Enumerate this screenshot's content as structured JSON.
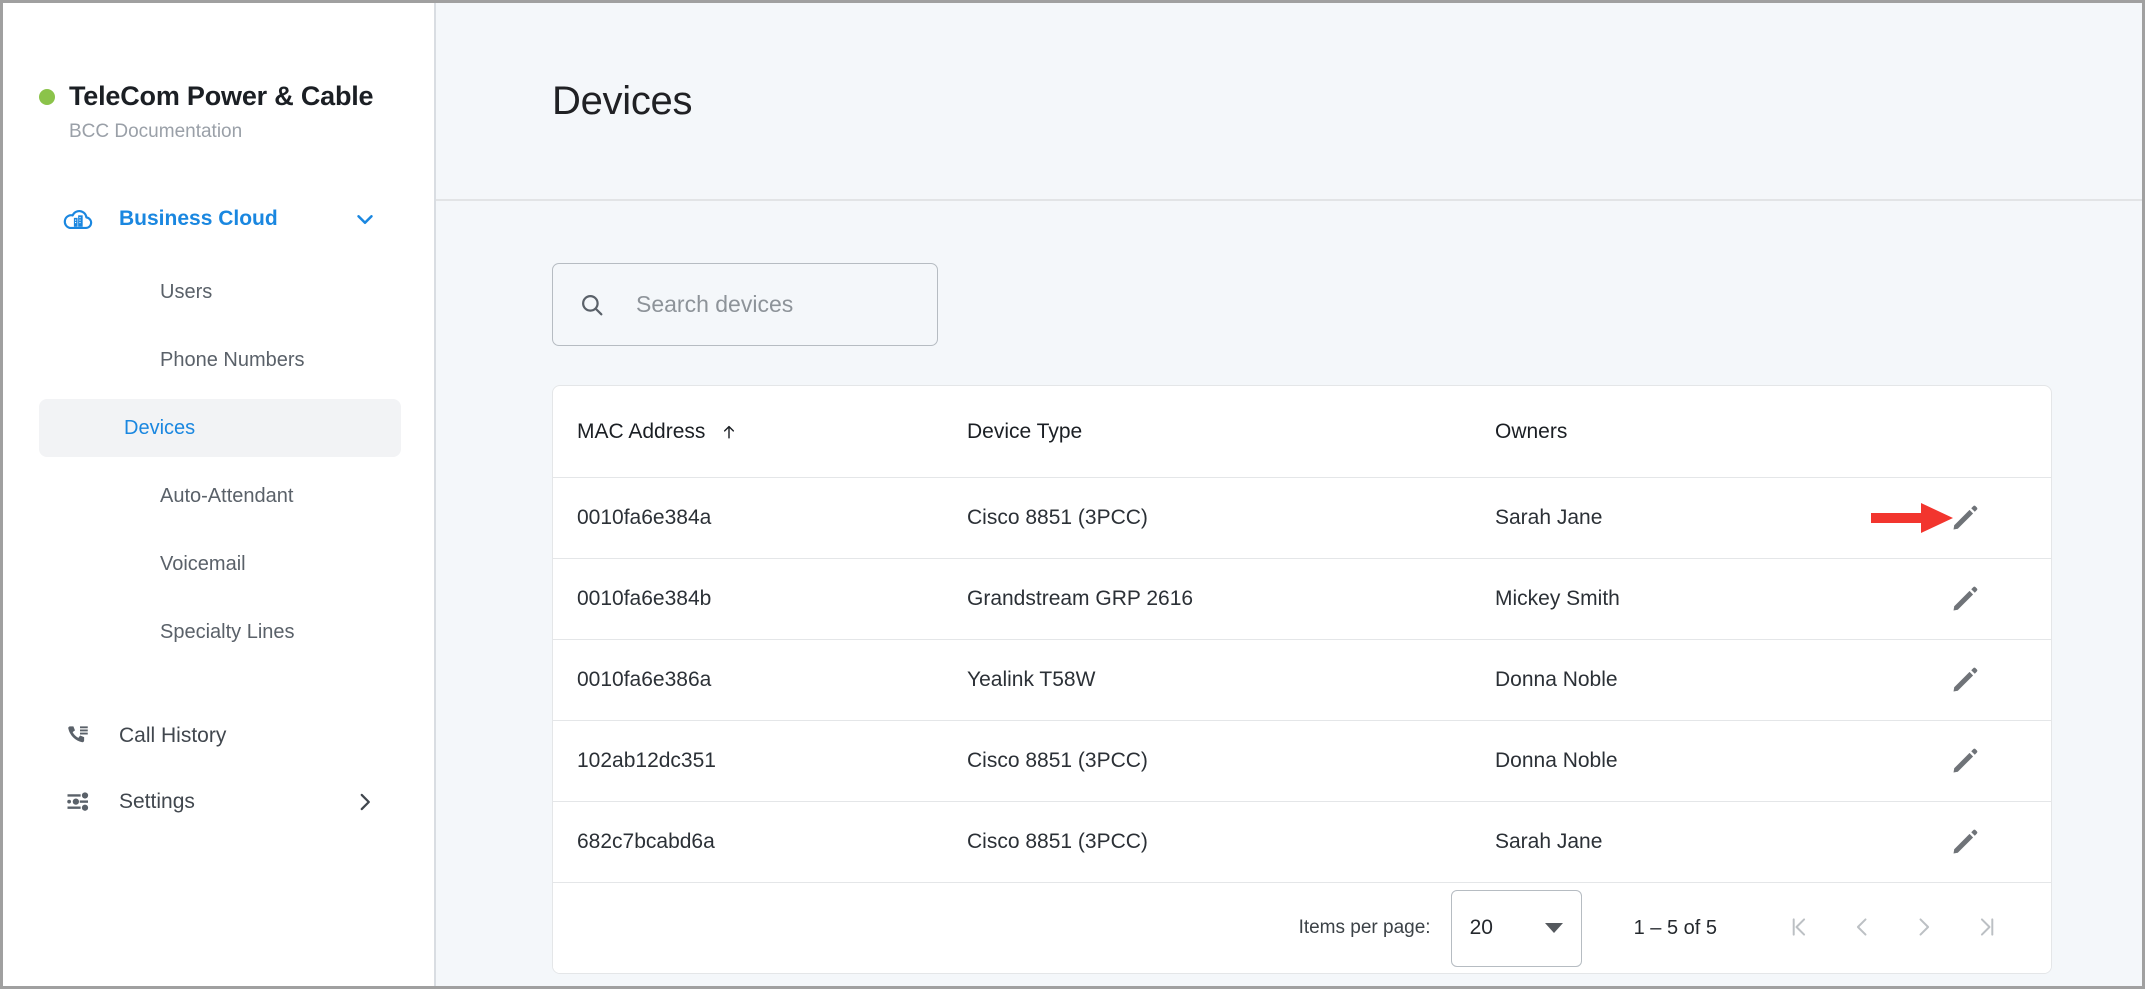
{
  "sidebar": {
    "brand": {
      "status_dot_color": "#8bc34a",
      "title": "TeleCom Power & Cable",
      "subtitle": "BCC Documentation"
    },
    "group": {
      "icon": "business-cloud-icon",
      "label": "Business Cloud",
      "expanded": true,
      "chevron": "chevron-down-icon",
      "accent_color": "#1a87e0",
      "items": [
        {
          "label": "Users",
          "active": false
        },
        {
          "label": "Phone Numbers",
          "active": false
        },
        {
          "label": "Devices",
          "active": true
        },
        {
          "label": "Auto-Attendant",
          "active": false
        },
        {
          "label": "Voicemail",
          "active": false
        },
        {
          "label": "Specialty Lines",
          "active": false
        }
      ]
    },
    "bottom_items": [
      {
        "label": "Call History",
        "icon": "phone-list-icon",
        "chevron": null
      },
      {
        "label": "Settings",
        "icon": "tune-sliders-icon",
        "chevron": "chevron-right-icon"
      }
    ]
  },
  "header": {
    "title": "Devices"
  },
  "search": {
    "icon": "search-icon",
    "placeholder": "Search devices",
    "value": ""
  },
  "table": {
    "columns": [
      {
        "key": "mac",
        "label": "MAC Address",
        "sort": "asc",
        "sort_icon": "arrow-up-icon"
      },
      {
        "key": "type",
        "label": "Device Type",
        "sort": null
      },
      {
        "key": "owners",
        "label": "Owners",
        "sort": null
      },
      {
        "key": "actions",
        "label": "",
        "sort": null
      }
    ],
    "rows": [
      {
        "mac": "0010fa6e384a",
        "type": "Cisco 8851 (3PCC)",
        "owners": "Sarah Jane",
        "action_icon": "edit-pencil-icon",
        "annotated": true
      },
      {
        "mac": "0010fa6e384b",
        "type": "Grandstream GRP 2616",
        "owners": "Mickey Smith",
        "action_icon": "edit-pencil-icon",
        "annotated": false
      },
      {
        "mac": "0010fa6e386a",
        "type": "Yealink T58W",
        "owners": "Donna Noble",
        "action_icon": "edit-pencil-icon",
        "annotated": false
      },
      {
        "mac": "102ab12dc351",
        "type": "Cisco 8851 (3PCC)",
        "owners": "Donna Noble",
        "action_icon": "edit-pencil-icon",
        "annotated": false
      },
      {
        "mac": "682c7bcabd6a",
        "type": "Cisco 8851 (3PCC)",
        "owners": "Sarah Jane",
        "action_icon": "edit-pencil-icon",
        "annotated": false
      }
    ]
  },
  "paginator": {
    "items_per_page_label": "Items per page:",
    "items_per_page_value": "20",
    "range_label": "1 – 5 of 5",
    "buttons": [
      {
        "name": "first-page-button",
        "icon": "first-page-icon",
        "disabled": true
      },
      {
        "name": "previous-page-button",
        "icon": "chevron-left-icon",
        "disabled": true
      },
      {
        "name": "next-page-button",
        "icon": "chevron-right-icon",
        "disabled": true
      },
      {
        "name": "last-page-button",
        "icon": "last-page-icon",
        "disabled": true
      }
    ]
  },
  "annotation": {
    "arrow_color": "#f2352e",
    "points_to": "edit-pencil-icon row 1"
  }
}
